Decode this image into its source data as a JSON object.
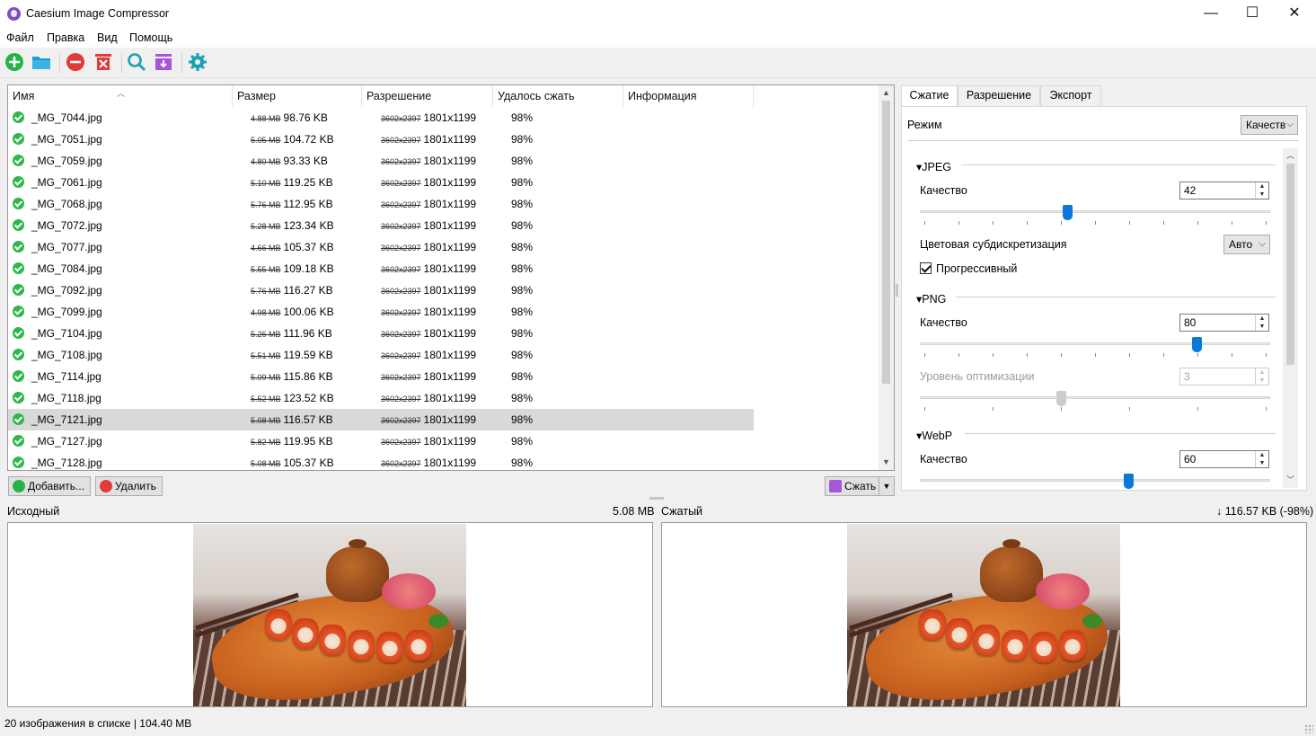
{
  "window": {
    "title": "Caesium Image Compressor",
    "minimize": "—",
    "maximize": "☐",
    "close": "✕"
  },
  "menu": [
    "Файл",
    "Правка",
    "Вид",
    "Помощь"
  ],
  "toolbar": {
    "icons": [
      "add-file-icon",
      "open-folder-icon",
      "remove-icon",
      "clear-list-icon",
      "search-icon",
      "export-icon",
      "settings-icon"
    ],
    "colors": {
      "green": "#27b34a",
      "blue": "#1a9ad6",
      "red": "#e03a3a",
      "purple": "#a855d8",
      "teal": "#1ba1b3"
    }
  },
  "table": {
    "columns": [
      "Имя",
      "Размер",
      "Разрешение",
      "Удалось сжать",
      "Информация"
    ],
    "rows": [
      {
        "name": "_MG_7044.jpg",
        "old_size": "4.88 MB",
        "new_size": "98.76 KB",
        "old_res": "3602x2397",
        "new_res": "1801x1199",
        "saved": "98%"
      },
      {
        "name": "_MG_7051.jpg",
        "old_size": "5.05 MB",
        "new_size": "104.72 KB",
        "old_res": "3602x2397",
        "new_res": "1801x1199",
        "saved": "98%"
      },
      {
        "name": "_MG_7059.jpg",
        "old_size": "4.80 MB",
        "new_size": "93.33 KB",
        "old_res": "3602x2397",
        "new_res": "1801x1199",
        "saved": "98%"
      },
      {
        "name": "_MG_7061.jpg",
        "old_size": "5.10 MB",
        "new_size": "119.25 KB",
        "old_res": "3602x2397",
        "new_res": "1801x1199",
        "saved": "98%"
      },
      {
        "name": "_MG_7068.jpg",
        "old_size": "5.76 MB",
        "new_size": "112.95 KB",
        "old_res": "3602x2397",
        "new_res": "1801x1199",
        "saved": "98%"
      },
      {
        "name": "_MG_7072.jpg",
        "old_size": "5.28 MB",
        "new_size": "123.34 KB",
        "old_res": "3602x2397",
        "new_res": "1801x1199",
        "saved": "98%"
      },
      {
        "name": "_MG_7077.jpg",
        "old_size": "4.66 MB",
        "new_size": "105.37 KB",
        "old_res": "3602x2397",
        "new_res": "1801x1199",
        "saved": "98%"
      },
      {
        "name": "_MG_7084.jpg",
        "old_size": "5.55 MB",
        "new_size": "109.18 KB",
        "old_res": "3602x2397",
        "new_res": "1801x1199",
        "saved": "98%"
      },
      {
        "name": "_MG_7092.jpg",
        "old_size": "5.76 MB",
        "new_size": "116.27 KB",
        "old_res": "3602x2397",
        "new_res": "1801x1199",
        "saved": "98%"
      },
      {
        "name": "_MG_7099.jpg",
        "old_size": "4.98 MB",
        "new_size": "100.06 KB",
        "old_res": "3602x2397",
        "new_res": "1801x1199",
        "saved": "98%"
      },
      {
        "name": "_MG_7104.jpg",
        "old_size": "5.26 MB",
        "new_size": "111.96 KB",
        "old_res": "3602x2397",
        "new_res": "1801x1199",
        "saved": "98%"
      },
      {
        "name": "_MG_7108.jpg",
        "old_size": "5.51 MB",
        "new_size": "119.59 KB",
        "old_res": "3602x2397",
        "new_res": "1801x1199",
        "saved": "98%"
      },
      {
        "name": "_MG_7114.jpg",
        "old_size": "5.09 MB",
        "new_size": "115.86 KB",
        "old_res": "3602x2397",
        "new_res": "1801x1199",
        "saved": "98%"
      },
      {
        "name": "_MG_7118.jpg",
        "old_size": "5.52 MB",
        "new_size": "123.52 KB",
        "old_res": "3602x2397",
        "new_res": "1801x1199",
        "saved": "98%"
      },
      {
        "name": "_MG_7121.jpg",
        "old_size": "5.08 MB",
        "new_size": "116.57 KB",
        "old_res": "3602x2397",
        "new_res": "1801x1199",
        "saved": "98%",
        "selected": true
      },
      {
        "name": "_MG_7127.jpg",
        "old_size": "5.82 MB",
        "new_size": "119.95 KB",
        "old_res": "3602x2397",
        "new_res": "1801x1199",
        "saved": "98%"
      },
      {
        "name": "_MG_7128.jpg",
        "old_size": "5.08 MB",
        "new_size": "105.37 KB",
        "old_res": "3602x2397",
        "new_res": "1801x1199",
        "saved": "98%"
      }
    ]
  },
  "buttons": {
    "add": "Добавить...",
    "remove": "Удалить",
    "compress": "Сжать"
  },
  "settings": {
    "tabs": [
      "Сжатие",
      "Разрешение",
      "Экспорт"
    ],
    "mode_label": "Режим",
    "mode_value": "Качеств",
    "jpeg": {
      "title": "JPEG",
      "quality_label": "Качество",
      "quality": "42",
      "quality_level": 0.42,
      "subsampling_label": "Цветовая субдискретизация",
      "subsampling_value": "Авто",
      "progressive_label": "Прогрессивный",
      "progressive": true
    },
    "png": {
      "title": "PNG",
      "quality_label": "Качество",
      "quality": "80",
      "quality_level": 0.8,
      "optimization_label": "Уровень оптимизации",
      "optimization": "3",
      "optimization_level": 0.4
    },
    "webp": {
      "title": "WebP",
      "quality_label": "Качество",
      "quality": "60",
      "quality_level": 0.6
    }
  },
  "preview": {
    "original_label": "Исходный",
    "original_size": "5.08 MB",
    "compressed_label": "Сжатый",
    "compressed_size": "↓ 116.57 KB (-98%)"
  },
  "status": "20 изображения в списке | 104.40 MB"
}
